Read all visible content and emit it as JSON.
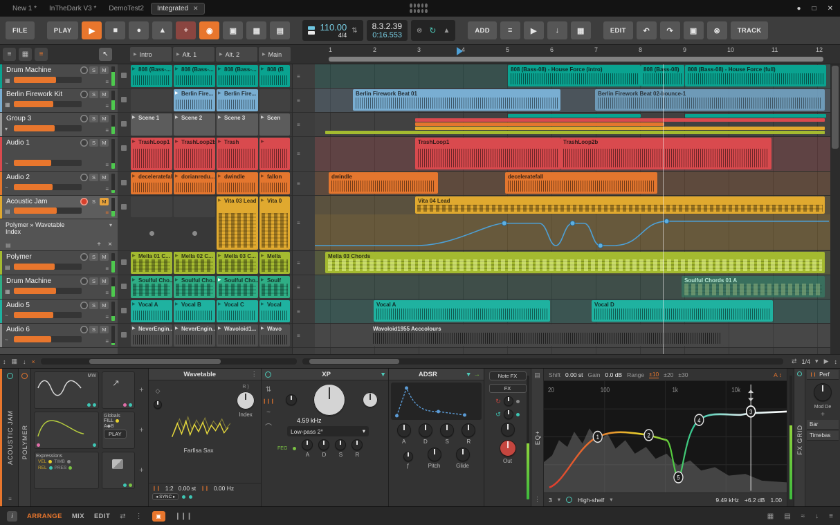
{
  "titlebar": {
    "tabs": [
      {
        "label": "New 1 *"
      },
      {
        "label": "InTheDark V3 *"
      },
      {
        "label": "DemoTest2"
      },
      {
        "label": "Integrated"
      }
    ],
    "close_tab": "✕"
  },
  "toolbar": {
    "file": "FILE",
    "play": "PLAY",
    "tempo": "110.00",
    "meter": "4/4",
    "position": "8.3.2.39",
    "time": "0:16.553",
    "add": "ADD",
    "edit": "EDIT",
    "track": "TRACK"
  },
  "labels": {
    "solo": "S",
    "mute": "M"
  },
  "scenes": [
    "Intro",
    "Alt. 1",
    "Alt. 2",
    "Main"
  ],
  "tracks": [
    {
      "name": "Drum Machine"
    },
    {
      "name": "Berlin Firework Kit"
    },
    {
      "name": "Group 3"
    },
    {
      "name": "Audio 1"
    },
    {
      "name": "Audio 2"
    },
    {
      "name": "Acoustic Jam",
      "device_line1": "Polymer » Wavetable",
      "device_line2": "Index"
    },
    {
      "name": "Polymer"
    },
    {
      "name": "Drum Machine"
    },
    {
      "name": "Audio 5"
    },
    {
      "name": "Audio 6"
    }
  ],
  "launcher": {
    "rows": [
      [
        "808 (Bass-...",
        "808 (Bass-...",
        "808 (Bass-...",
        "808 (B"
      ],
      [
        "",
        "Berlin Fire...",
        "Berlin Fire...",
        ""
      ],
      [
        "Scene 1",
        "Scene 2",
        "Scene 3",
        "Scen"
      ],
      [
        "TrashLoop1",
        "TrashLoop2b",
        "Trash",
        ""
      ],
      [
        "deceleratefall",
        "dorianredu...",
        "dwindle",
        "fallon"
      ],
      [
        "",
        "",
        "Vita 03 Lead",
        "Vita 0"
      ],
      [
        "Mella 01 C...",
        "Mella 02 C...",
        "Mella 03 C...",
        "Mella"
      ],
      [
        "Soulful Cho...",
        "Soulful Cho...",
        "Soulful Cho...",
        "Soulf"
      ],
      [
        "Vocal A",
        "Vocal B",
        "Vocal C",
        "Vocal"
      ],
      [
        "NeverEngin...",
        "NeverEngin...",
        "Wavoloid1...",
        "Wavo"
      ]
    ]
  },
  "arranger": {
    "ruler": [
      "1",
      "2",
      "3",
      "4",
      "5",
      "6",
      "7",
      "8",
      "9",
      "10",
      "11",
      "12"
    ],
    "clips": {
      "c808_intro": "808 (Bass-08) - House Force (intro)",
      "c808_mid": "808 (Bass-08)",
      "c808_full": "808 (Bass-08) - House Force (full)",
      "berlin1": "Berlin Firework Beat 01",
      "berlin2": "Berlin Firework Beat 02-bounce-1",
      "trash1": "TrashLoop1",
      "trash2": "TrashLoop2b",
      "dwindle": "dwindle",
      "decelerate": "deceleratefall",
      "vita": "Vita 04 Lead",
      "mella": "Mella 03 Chords",
      "soulful": "Soulful Chords 01 A",
      "vocal_a": "Vocal A",
      "vocal_d": "Vocal D",
      "wavoloid": "Wavoloid1955 Acccolours"
    },
    "grid": "1/4"
  },
  "device_panel": {
    "track_label": "ACOUSTIC JAM",
    "polymer_label": "POLYMER",
    "polymer": {
      "osc": "MW",
      "globals": "Globals",
      "fill": "FILL",
      "ab": "A◆B",
      "play": "PLAY",
      "expressions": "Expressions",
      "vel": "VEL",
      "timb": "TIMB",
      "rel": "REL",
      "pres": "PRES"
    },
    "wavetable": {
      "title": "Wavetable",
      "preset": "Farfisa Sax",
      "index": "Index",
      "ratio": "1:2",
      "detune": "0.00 st",
      "freq": "0.00 Hz",
      "sync": "SYNC"
    },
    "xp": {
      "title": "XP",
      "cutoff": "4.59 kHz",
      "mode": "Low-pass 2°",
      "feg": "FEG",
      "a": "A",
      "d": "D",
      "s": "S",
      "r": "R"
    },
    "adsr": {
      "title": "ADSR",
      "a": "A",
      "d": "D",
      "s": "S",
      "r": "R",
      "pitch": "Pitch",
      "glide": "Glide"
    },
    "notefx": "Note FX",
    "fx": "FX",
    "out": "Out",
    "eq": {
      "label": "EQ+",
      "shift_label": "Shift",
      "shift": "0.00 st",
      "gain_label": "Gain",
      "gain": "0.0 dB",
      "range_label": "Range",
      "r10": "±10",
      "r20": "±20",
      "r30": "±30",
      "f20": "20",
      "f100": "100",
      "f1k": "1k",
      "f10k": "10k",
      "bands": "3",
      "band_type": "High-shelf",
      "freq": "9.49 kHz",
      "band_gain": "+6.2 dB",
      "q": "1.00",
      "n1": "1",
      "n2": "2",
      "n3": "3",
      "n4": "4",
      "n5": "5",
      "auto": "A"
    },
    "fxgrid_label": "FX GRID",
    "right": {
      "perf": "Perf",
      "mod": "Mod De",
      "bar": "Bar",
      "timebase": "Timebas",
      "plus": "+"
    }
  },
  "statusbar": {
    "info": "i",
    "tabs": [
      "ARRANGE",
      "MIX",
      "EDIT"
    ]
  }
}
